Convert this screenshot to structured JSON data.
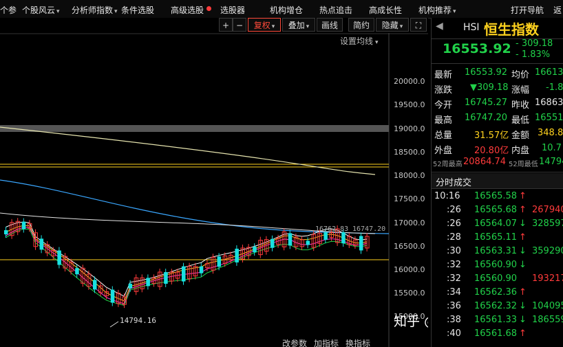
{
  "menu": {
    "items": [
      "个参",
      "个股风云",
      "分析师指数",
      "条件选股",
      "高级选股",
      "选股器",
      "机构增仓",
      "热点追击",
      "高成长性",
      "机构推荐",
      "打开导航",
      "返"
    ],
    "caret": "▾"
  },
  "toolbar": {
    "plus": "+",
    "minus": "−",
    "fuquan": "复权",
    "diejia": "叠加",
    "huaxian": "画线",
    "jianyue": "简约",
    "yincang": "隐藏",
    "fullscreen": "⛶",
    "set_ma": "设置均线"
  },
  "chart": {
    "price_axis": [
      "20000.0",
      "19500.0",
      "19000.0",
      "18500.0",
      "18000.0",
      "17500.0",
      "17000.0",
      "16500.0",
      "16000.0",
      "15500.0",
      "15000.0"
    ],
    "low_label": "14794.16",
    "high_label": "16762.83",
    "last_label": "16747.20",
    "bottom_tabs": [
      "改参数",
      "加指标",
      "换指标"
    ]
  },
  "quote": {
    "code": "HSI",
    "name": "恒生指数",
    "price": "16553.92",
    "change": "- 309.18",
    "pct": "- 1.83%",
    "rows": [
      {
        "l1": "最新",
        "v1": "16553.92",
        "l2": "均价",
        "v2": "16613"
      },
      {
        "l1": "涨跌",
        "v1": "▼309.18",
        "l2": "涨幅",
        "v2": "-1.8"
      },
      {
        "l1": "今开",
        "v1": "16745.27",
        "l2": "昨收",
        "v2": "16863"
      },
      {
        "l1": "最高",
        "v1": "16747.20",
        "l2": "最低",
        "v2": "16551"
      },
      {
        "l1": "总量",
        "v1": "31.57亿",
        "l2": "金额",
        "v2": "348.8"
      },
      {
        "l1": "外盘",
        "v1": "20.80亿",
        "l2": "内盘",
        "v2": "10.7"
      }
    ],
    "w52_high_label": "52周最高",
    "w52_high": "20864.74",
    "w52_low_label": "52周最低",
    "w52_low": "14794"
  },
  "ticks": {
    "title": "分时成交",
    "rows": [
      {
        "t": "10:16",
        "p": "16565.58",
        "d": "↑",
        "v": ""
      },
      {
        "t": ":26",
        "p": "16565.68",
        "d": "↑",
        "v": "267940"
      },
      {
        "t": ":26",
        "p": "16564.07",
        "d": "↓",
        "v": "328597"
      },
      {
        "t": ":28",
        "p": "16565.11",
        "d": "↑",
        "v": ""
      },
      {
        "t": ":30",
        "p": "16563.31",
        "d": "↓",
        "v": "359290"
      },
      {
        "t": ":32",
        "p": "16560.90",
        "d": "↓",
        "v": ""
      },
      {
        "t": ":32",
        "p": "16560.90",
        "d": "",
        "v": "193217"
      },
      {
        "t": ":34",
        "p": "16562.36",
        "d": "↑",
        "v": ""
      },
      {
        "t": ":36",
        "p": "16562.32",
        "d": "↓",
        "v": "104095"
      },
      {
        "t": ":38",
        "p": "16561.33",
        "d": "↓",
        "v": "186559"
      },
      {
        "t": ":40",
        "p": "16561.68",
        "d": "↑",
        "v": ""
      }
    ]
  },
  "watermark": "知乎 @刘叔投资笔记",
  "colors": {
    "up": "#ff3b3b",
    "down": "#19e0e0",
    "bg": "#000000"
  }
}
